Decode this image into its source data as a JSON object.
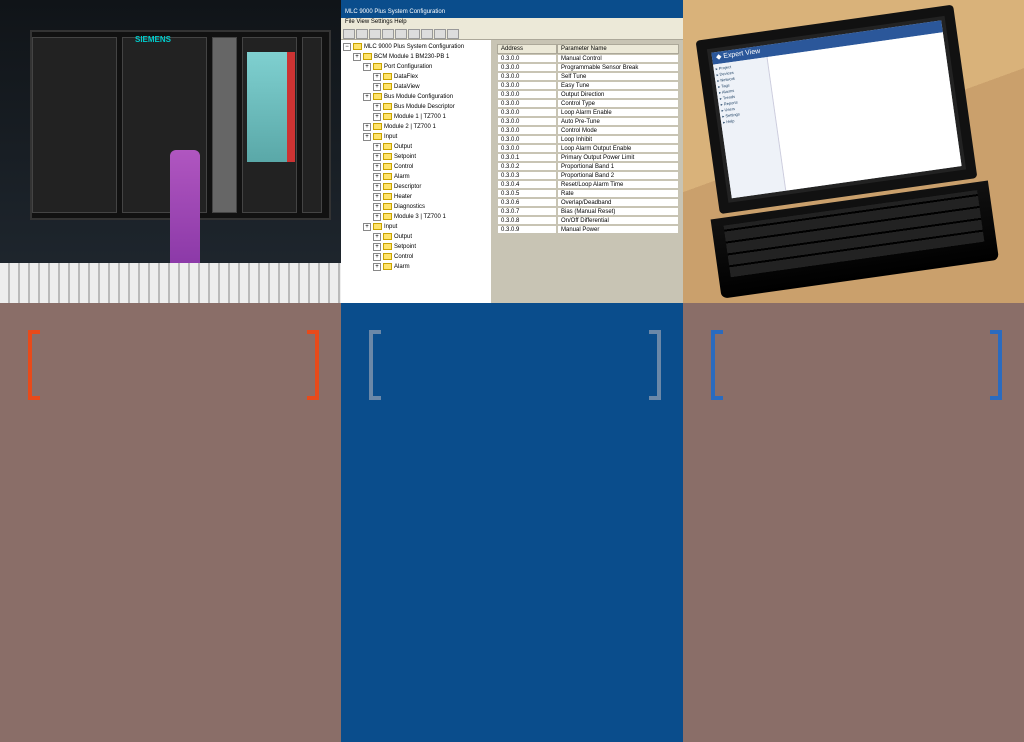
{
  "columns": {
    "left": {
      "caption": "",
      "body": ""
    },
    "mid": {
      "caption": "",
      "body": ""
    },
    "right": {
      "caption": "",
      "body": ""
    }
  },
  "plc": {
    "brand": "SIEMENS"
  },
  "cfg": {
    "window_title": "MLC 9000 Plus System Configuration",
    "menu": "File  View  Settings  Help",
    "tree_root": "MLC 9000 Plus System Configuration",
    "tree": [
      "BCM Module 1 BM230-PB 1",
      "Port Configuration",
      "DataFlex",
      "DataView",
      "Bus Module Configuration",
      "Bus Module Descriptor",
      "Module 1 | TZ700 1",
      "Module 2 | TZ700 1",
      "Input",
      "Output",
      "Setpoint",
      "Control",
      "Alarm",
      "Descriptor",
      "Heater",
      "Diagnostics",
      "Module 3 | TZ700 1",
      "Input",
      "Output",
      "Setpoint",
      "Control",
      "Alarm"
    ],
    "grid_headers": {
      "address": "Address",
      "param": "Parameter Name"
    },
    "rows": [
      {
        "addr": "0.3.0.0",
        "name": "Manual Control"
      },
      {
        "addr": "0.3.0.0",
        "name": "Programmable Sensor Break"
      },
      {
        "addr": "0.3.0.0",
        "name": "Self Tune"
      },
      {
        "addr": "0.3.0.0",
        "name": "Easy Tune"
      },
      {
        "addr": "0.3.0.0",
        "name": "Output Direction"
      },
      {
        "addr": "0.3.0.0",
        "name": "Control Type"
      },
      {
        "addr": "0.3.0.0",
        "name": "Loop Alarm Enable"
      },
      {
        "addr": "0.3.0.0",
        "name": "Auto Pre-Tune"
      },
      {
        "addr": "0.3.0.0",
        "name": "Control Mode"
      },
      {
        "addr": "0.3.0.0",
        "name": "Loop Inhibit"
      },
      {
        "addr": "0.3.0.0",
        "name": "Loop Alarm Output Enable"
      },
      {
        "addr": "0.3.0.1",
        "name": "Primary Output Power Limit"
      },
      {
        "addr": "0.3.0.2",
        "name": "Proportional Band 1"
      },
      {
        "addr": "0.3.0.3",
        "name": "Proportional Band 2"
      },
      {
        "addr": "0.3.0.4",
        "name": "Reset/Loop Alarm Time"
      },
      {
        "addr": "0.3.0.5",
        "name": "Rate"
      },
      {
        "addr": "0.3.0.6",
        "name": "Overlap/Deadband"
      },
      {
        "addr": "0.3.0.7",
        "name": "Bias (Manual Reset)"
      },
      {
        "addr": "0.3.0.8",
        "name": "On/Off Differential"
      },
      {
        "addr": "0.3.0.9",
        "name": "Manual Power"
      }
    ]
  },
  "laptop": {
    "app_title": "Expert View",
    "nav_items": [
      "Project",
      "Devices",
      "Network",
      "Tags",
      "Alarms",
      "Trends",
      "Reports",
      "Users",
      "Settings",
      "Help"
    ]
  }
}
